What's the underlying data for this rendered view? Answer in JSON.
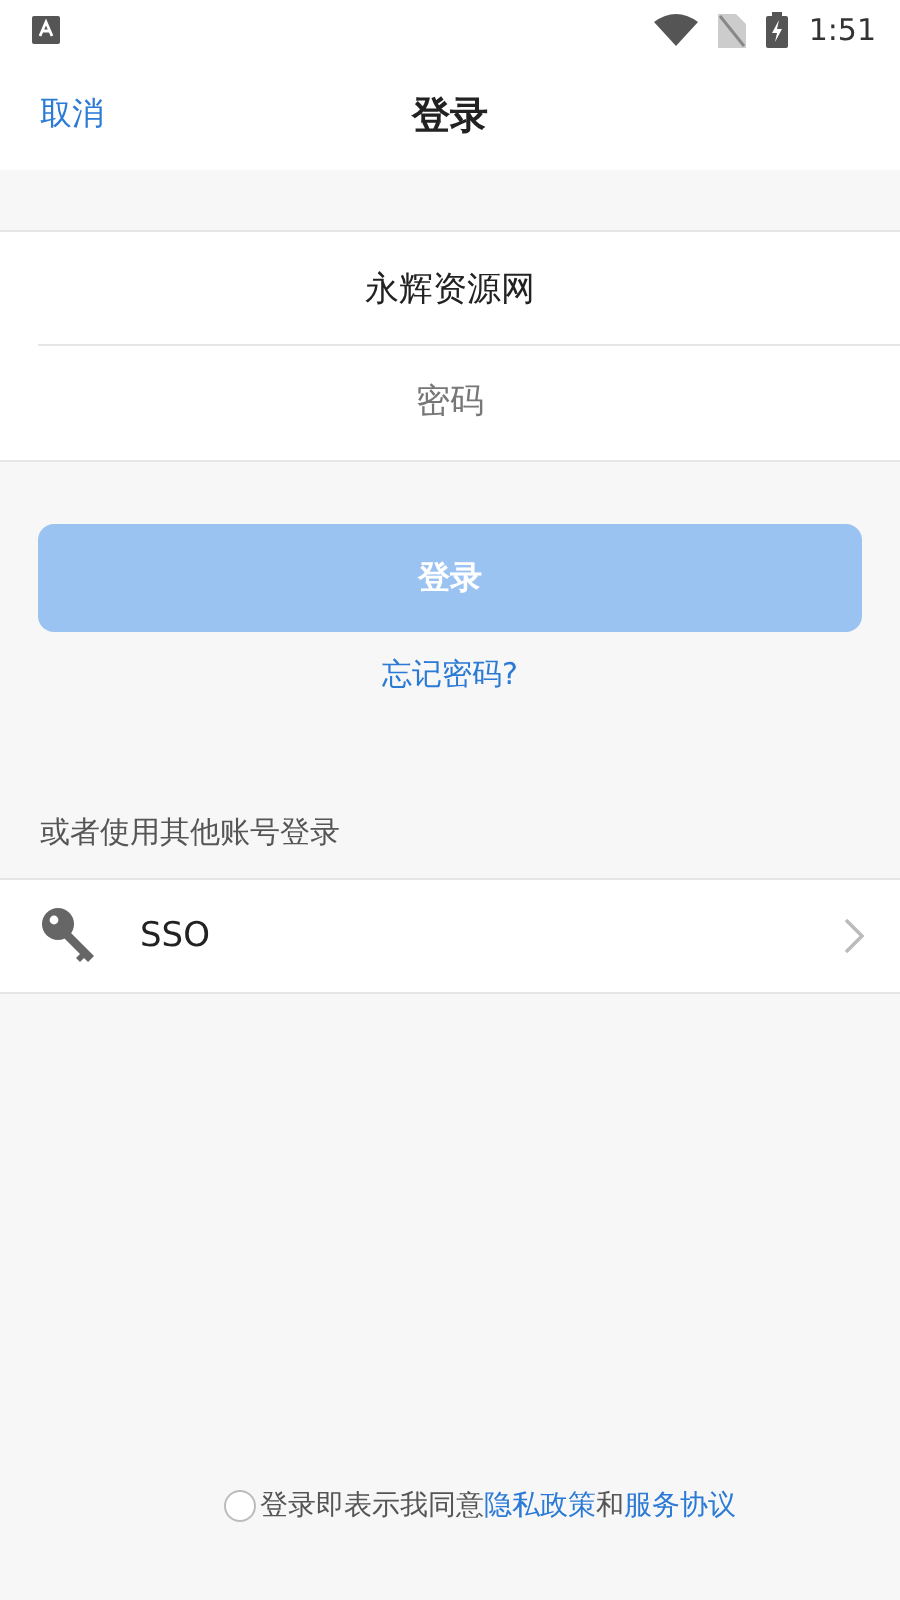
{
  "status_bar": {
    "time": "1:51"
  },
  "nav": {
    "cancel": "取消",
    "title": "登录"
  },
  "fields": [
    {
      "kind": "value",
      "value": "永辉资源网"
    },
    {
      "kind": "placeholder",
      "placeholder": "密码"
    }
  ],
  "login_button": {
    "label": "登录",
    "disabled": true
  },
  "forgot_link": "忘记密码?",
  "other_login": {
    "label": "或者使用其他账号登录",
    "items": [
      {
        "label": "SSO"
      }
    ]
  },
  "agreement": {
    "checked": false,
    "parts": [
      {
        "kind": "text",
        "text": "登录即表示我同意"
      },
      {
        "kind": "link",
        "text": "隐私政策"
      },
      {
        "kind": "text",
        "text": "和"
      },
      {
        "kind": "link",
        "text": "服务协议"
      }
    ]
  }
}
